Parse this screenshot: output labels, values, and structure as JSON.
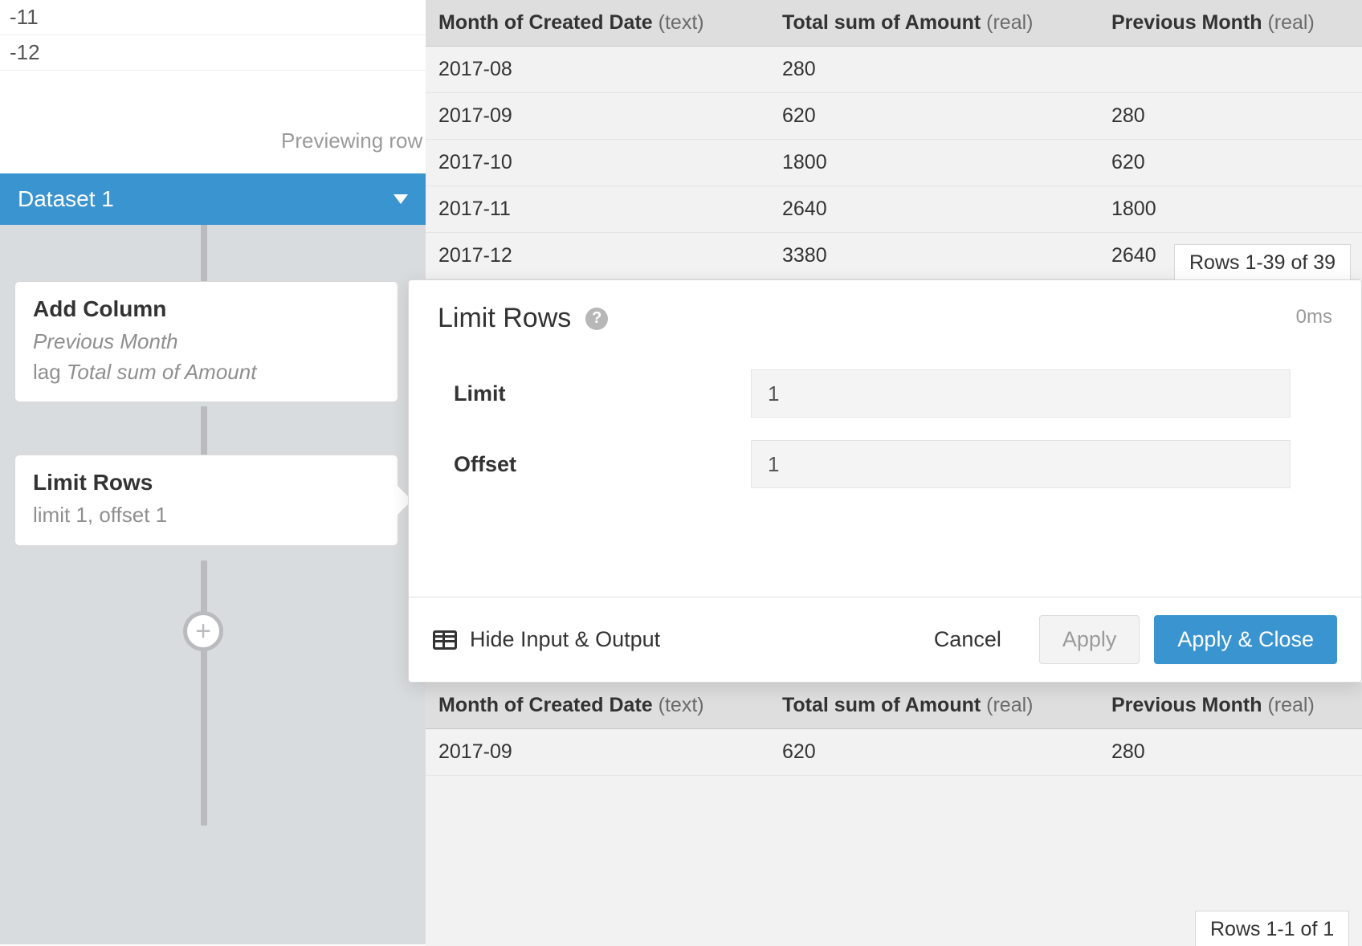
{
  "faint_list": [
    "-11",
    "-12"
  ],
  "previewing": "Previewing row",
  "pipeline": {
    "dataset": "Dataset 1",
    "node1": {
      "title": "Add Column",
      "sub1": "Previous Month",
      "sub2_prefix": "lag ",
      "sub2_em": "Total sum of Amount"
    },
    "node2": {
      "title": "Limit Rows",
      "sub": "limit 1, offset 1"
    },
    "add_symbol": "+"
  },
  "columns": {
    "c1_name": "Month of Created Date",
    "c1_type": "(text)",
    "c2_name": "Total sum of Amount",
    "c2_type": "(real)",
    "c3_name": "Previous Month",
    "c3_type": "(real)"
  },
  "input_rows": [
    {
      "a": "2017-08",
      "b": "280",
      "c": ""
    },
    {
      "a": "2017-09",
      "b": "620",
      "c": "280"
    },
    {
      "a": "2017-10",
      "b": "1800",
      "c": "620"
    },
    {
      "a": "2017-11",
      "b": "2640",
      "c": "1800"
    },
    {
      "a": "2017-12",
      "b": "3380",
      "c": "2640"
    }
  ],
  "rows_in_badge": "Rows 1-39 of 39",
  "output_rows": [
    {
      "a": "2017-09",
      "b": "620",
      "c": "280"
    }
  ],
  "rows_out_badge": "Rows 1-1 of 1",
  "panel": {
    "title": "Limit Rows",
    "help": "?",
    "time": "0ms",
    "limit_label": "Limit",
    "limit_value": "1",
    "offset_label": "Offset",
    "offset_value": "1",
    "toggle": "Hide Input & Output",
    "cancel": "Cancel",
    "apply": "Apply",
    "apply_close": "Apply & Close"
  }
}
